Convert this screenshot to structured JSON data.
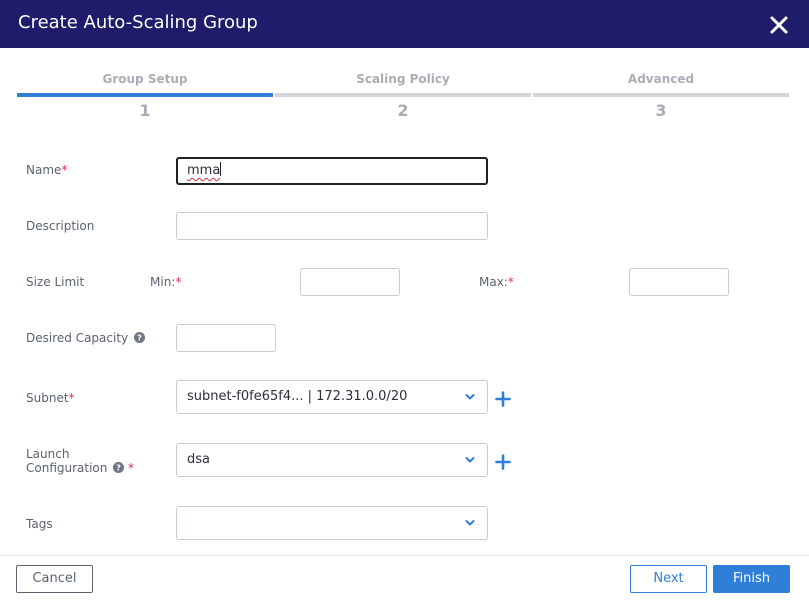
{
  "dialog": {
    "title": "Create Auto-Scaling Group",
    "close_icon": "close-icon"
  },
  "steps": [
    {
      "label": "Group Setup",
      "number": "1",
      "active": true
    },
    {
      "label": "Scaling Policy",
      "number": "2",
      "active": false
    },
    {
      "label": "Advanced",
      "number": "3",
      "active": false
    }
  ],
  "form": {
    "name": {
      "label": "Name",
      "required": "*",
      "value": "mma"
    },
    "description": {
      "label": "Description",
      "value": ""
    },
    "size_limit": {
      "label": "Size Limit",
      "min_label": "Min:",
      "max_label": "Max:",
      "required": "*",
      "min_value": "",
      "max_value": ""
    },
    "desired_capacity": {
      "label": "Desired Capacity",
      "value": ""
    },
    "subnet": {
      "label": "Subnet",
      "required": "*",
      "value": "subnet-f0fe65f4... | 172.31.0.0/20"
    },
    "launch_configuration": {
      "label_line1": "Launch",
      "label_line2": "Configuration",
      "required": "*",
      "value": "dsa"
    },
    "tags": {
      "label": "Tags",
      "value": ""
    }
  },
  "footer": {
    "cancel_label": "Cancel",
    "next_label": "Next",
    "finish_label": "Finish"
  },
  "colors": {
    "header": "#1e1c6b",
    "accent": "#2f7fd9",
    "required": "#d9304a"
  }
}
